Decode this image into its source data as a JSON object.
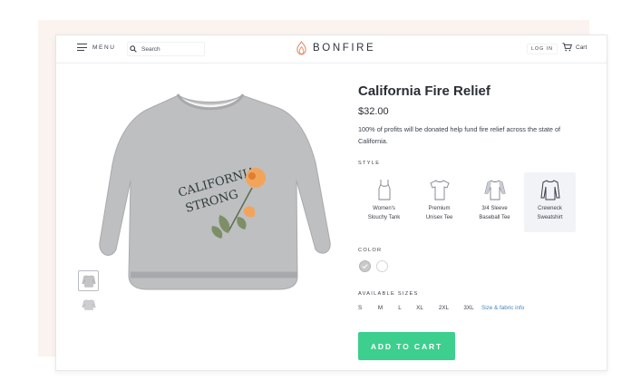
{
  "header": {
    "menu_label": "MENU",
    "search_placeholder": "Search",
    "brand": "BONFIRE",
    "login_label": "LOG IN",
    "cart_label": "Cart"
  },
  "product": {
    "title": "California Fire Relief",
    "price": "$32.00",
    "description": "100% of profits will be donated help fund fire relief across the state of California.",
    "graphic_text": [
      "CALIFORNIA",
      "STRONG"
    ]
  },
  "style": {
    "label": "STYLE",
    "options": [
      {
        "line1": "Women's",
        "line2": "Slouchy Tank",
        "icon": "tank-icon",
        "selected": false
      },
      {
        "line1": "Premium",
        "line2": "Unisex Tee",
        "icon": "tshirt-icon",
        "selected": false
      },
      {
        "line1": "3/4 Sleeve",
        "line2": "Baseball Tee",
        "icon": "baseball-tee-icon",
        "selected": false
      },
      {
        "line1": "Crewneck",
        "line2": "Sweatshirt",
        "icon": "sweatshirt-icon",
        "selected": true
      }
    ]
  },
  "color": {
    "label": "COLOR",
    "swatches": [
      {
        "name": "gray",
        "hex": "#c9c9c9",
        "selected": true
      },
      {
        "name": "white",
        "hex": "#ffffff",
        "selected": false
      }
    ]
  },
  "sizes": {
    "label": "AVAILABLE SIZES",
    "items": [
      "S",
      "M",
      "L",
      "XL",
      "2XL",
      "3XL"
    ],
    "guide_link": "Size & fabric info"
  },
  "cta": {
    "label": "ADD TO CART",
    "color": "#3ccf8e"
  }
}
